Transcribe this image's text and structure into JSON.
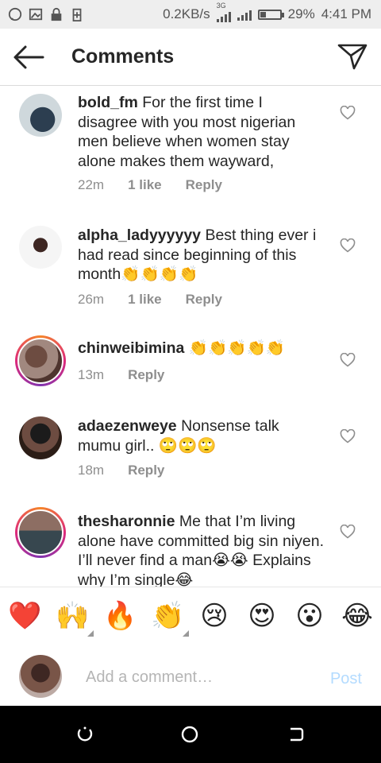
{
  "status": {
    "speed": "0.2KB/s",
    "network": "3G",
    "battery": "29%",
    "time": "4:41 PM"
  },
  "header": {
    "title": "Comments"
  },
  "comments": [
    {
      "username": "bold_fm",
      "text": "For the first time I disagree with you most nigerian men believe when women stay alone makes them wayward,",
      "time": "22m",
      "likes": "1 like",
      "reply": "Reply",
      "story": false
    },
    {
      "username": "alpha_ladyyyyyy",
      "text": "Best thing ever i had read since beginning of this month👏👏👏👏",
      "time": "26m",
      "likes": "1 like",
      "reply": "Reply",
      "story": false
    },
    {
      "username": "chinweibimina",
      "text": "👏👏👏👏👏",
      "time": "13m",
      "reply": "Reply",
      "story": true
    },
    {
      "username": "adaezenweye",
      "text": "Nonsense talk mumu girl.. 🙄🙄🙄",
      "time": "18m",
      "reply": "Reply",
      "story": false
    },
    {
      "username": "thesharonnie",
      "text": "Me that I’m living alone have committed big sin niyen. I’ll never find a man😭😭 Explains why I’m single😂",
      "story": true
    }
  ],
  "emoji_bar": [
    "❤️",
    "🙌",
    "🔥",
    "👏",
    "😢",
    "😍",
    "😮",
    "😂"
  ],
  "input": {
    "placeholder": "Add a comment…",
    "post_label": "Post"
  },
  "colors": {
    "accent": "#3897f0",
    "post_disabled": "#b3dbff",
    "muted": "#8e8e8e",
    "heart": "#e53935"
  }
}
